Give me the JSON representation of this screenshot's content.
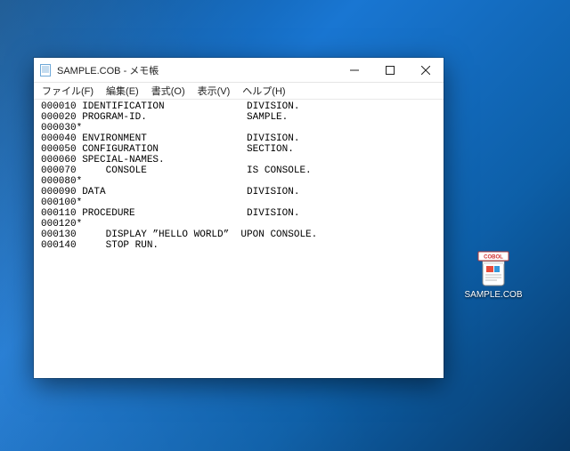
{
  "window": {
    "title": "SAMPLE.COB - メモ帳",
    "menu": {
      "file": "ファイル(F)",
      "edit": "編集(E)",
      "format": "書式(O)",
      "view": "表示(V)",
      "help": "ヘルプ(H)"
    },
    "content": "000010 IDENTIFICATION              DIVISION.\n000020 PROGRAM-ID.                 SAMPLE.\n000030*\n000040 ENVIRONMENT                 DIVISION.\n000050 CONFIGURATION               SECTION.\n000060 SPECIAL-NAMES.\n000070     CONSOLE                 IS CONSOLE.\n000080*\n000090 DATA                        DIVISION.\n000100*\n000110 PROCEDURE                   DIVISION.\n000120*\n000130     DISPLAY ”HELLO WORLD”  UPON CONSOLE.\n000140     STOP RUN."
  },
  "desktop": {
    "file_label": "SAMPLE.COB",
    "badge": "COBOL"
  }
}
